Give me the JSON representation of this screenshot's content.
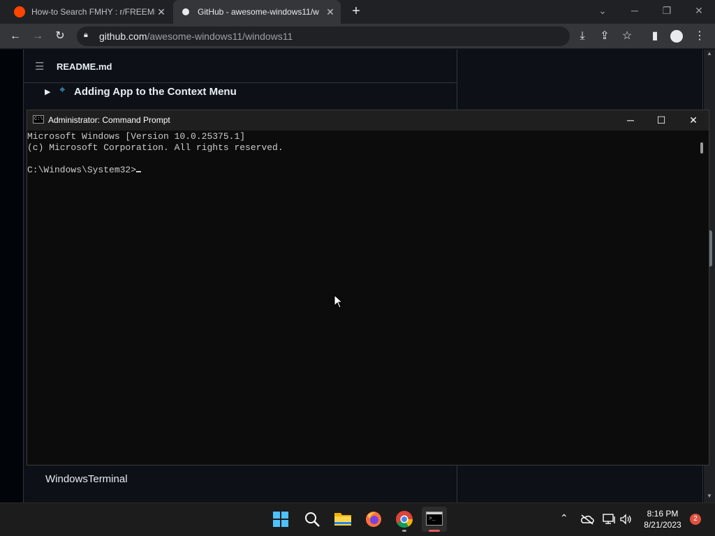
{
  "browser": {
    "tabs": [
      {
        "title": "How-to Search FMHY : r/FREEME",
        "icon": "reddit-icon"
      },
      {
        "title": "GitHub - awesome-windows11/w",
        "icon": "github-icon"
      }
    ],
    "url_host": "github.com",
    "url_path": "/awesome-windows11/windows11"
  },
  "readme": {
    "filename": "README.md",
    "section_heading": "Adding App to the Context Menu",
    "bottom_item": "WindowsTerminal"
  },
  "cmd": {
    "title": "Administrator: Command Prompt",
    "lines": [
      "Microsoft Windows [Version 10.0.25375.1]",
      "(c) Microsoft Corporation. All rights reserved.",
      "",
      "C:\\Windows\\System32>"
    ]
  },
  "taskbar": {
    "time": "8:16 PM",
    "date": "8/21/2023",
    "notification_count": "2"
  },
  "colors": {
    "accent_blue": "#4cc2ff",
    "notification_red": "#e81123"
  }
}
